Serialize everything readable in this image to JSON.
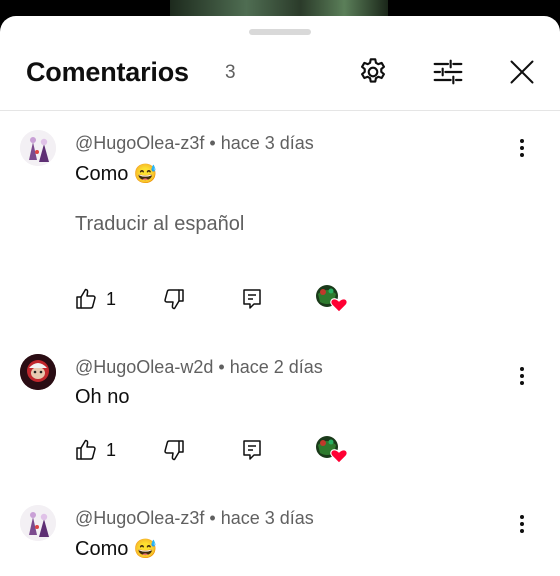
{
  "header": {
    "title": "Comentarios",
    "count": "3"
  },
  "comments": [
    {
      "author": "@HugoOlea-z3f",
      "time": "hace 3 días",
      "text": "Como",
      "emoji": "😅",
      "translate": "Traducir al español",
      "likes": "1"
    },
    {
      "author": "@HugoOlea-w2d",
      "time": "hace 2 días",
      "text": "Oh no",
      "emoji": "",
      "likes": "1"
    },
    {
      "author": "@HugoOlea-z3f",
      "time": "hace 3 días",
      "text": "Como",
      "emoji": "😅"
    }
  ],
  "separator": "•",
  "icons": {
    "settings": "gear-icon",
    "filter": "sliders-icon",
    "close": "close-icon",
    "like": "thumbs-up-icon",
    "dislike": "thumbs-down-icon",
    "reply": "reply-icon",
    "more": "more-vert-icon",
    "creator_heart": "creator-heart-icon"
  },
  "colors": {
    "heart": "#ff0033",
    "secondary_text": "#606060"
  }
}
